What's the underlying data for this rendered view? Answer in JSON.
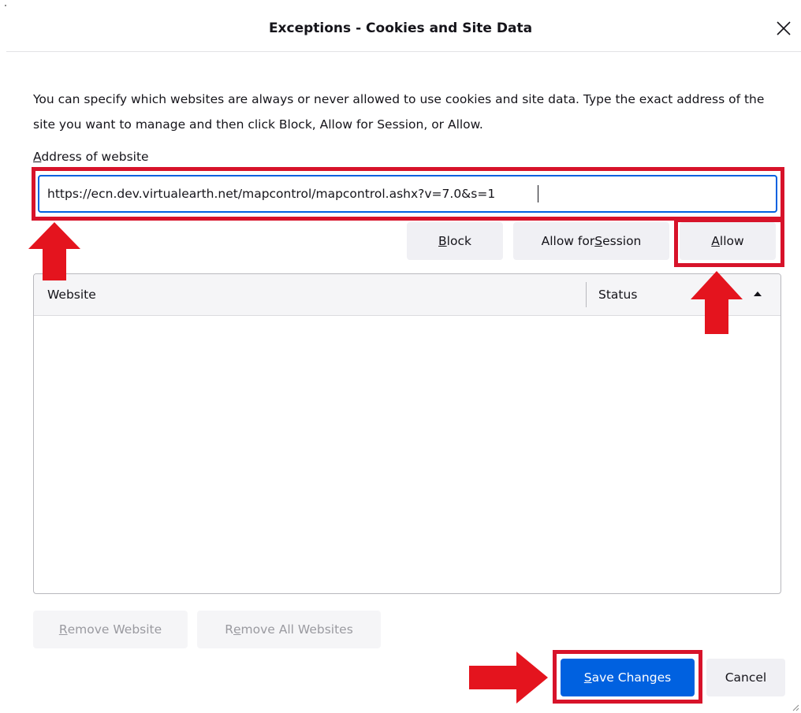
{
  "dialog": {
    "title": "Exceptions - Cookies and Site Data",
    "close_icon": "close-icon"
  },
  "description": "You can specify which websites are always or never allowed to use cookies and site data. Type the exact address of the site you want to manage and then click Block, Allow for Session, or Allow.",
  "address": {
    "label_accesskey": "A",
    "label_rest": "ddress of website",
    "value": "https://ecn.dev.virtualearth.net/mapcontrol/mapcontrol.ashx?v=7.0&s=1"
  },
  "buttons": {
    "block_key": "B",
    "block_rest": "lock",
    "allow_session_pre": "Allow for ",
    "allow_session_key": "S",
    "allow_session_rest": "ession",
    "allow_key": "A",
    "allow_rest": "llow"
  },
  "table": {
    "columns": [
      "Website",
      "Status"
    ],
    "rows": []
  },
  "footer": {
    "remove_website_key": "R",
    "remove_website_rest": "emove Website",
    "remove_all_pre": "R",
    "remove_all_key": "e",
    "remove_all_rest": "move All Websites",
    "save_key": "S",
    "save_rest": "ave Changes",
    "cancel_label": "Cancel"
  },
  "annotation_color": "#d7132a",
  "accent_color": "#0061e0"
}
